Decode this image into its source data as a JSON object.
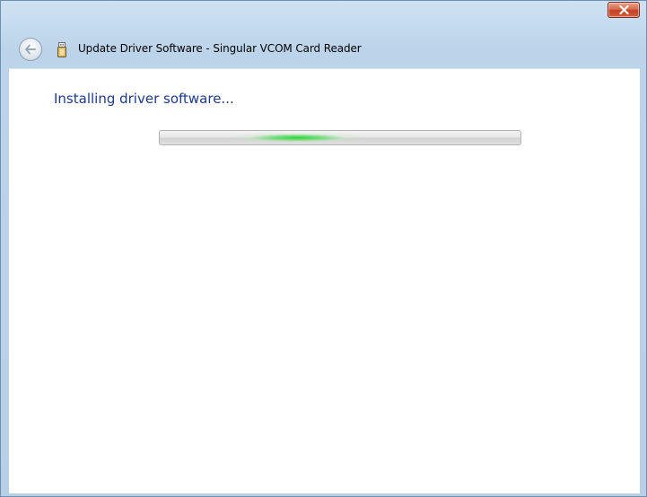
{
  "window": {
    "title": "Update Driver Software - Singular VCOM Card Reader",
    "close_icon": "close-icon",
    "back_icon": "back-arrow-icon",
    "device_icon": "usb-device-icon"
  },
  "content": {
    "heading": "Installing driver software...",
    "progress": {
      "state": "indeterminate",
      "accent_color": "#2ed638"
    }
  },
  "colors": {
    "heading": "#1e3a8c",
    "frame": "#b7d0e8",
    "close_button": "#c44023"
  }
}
